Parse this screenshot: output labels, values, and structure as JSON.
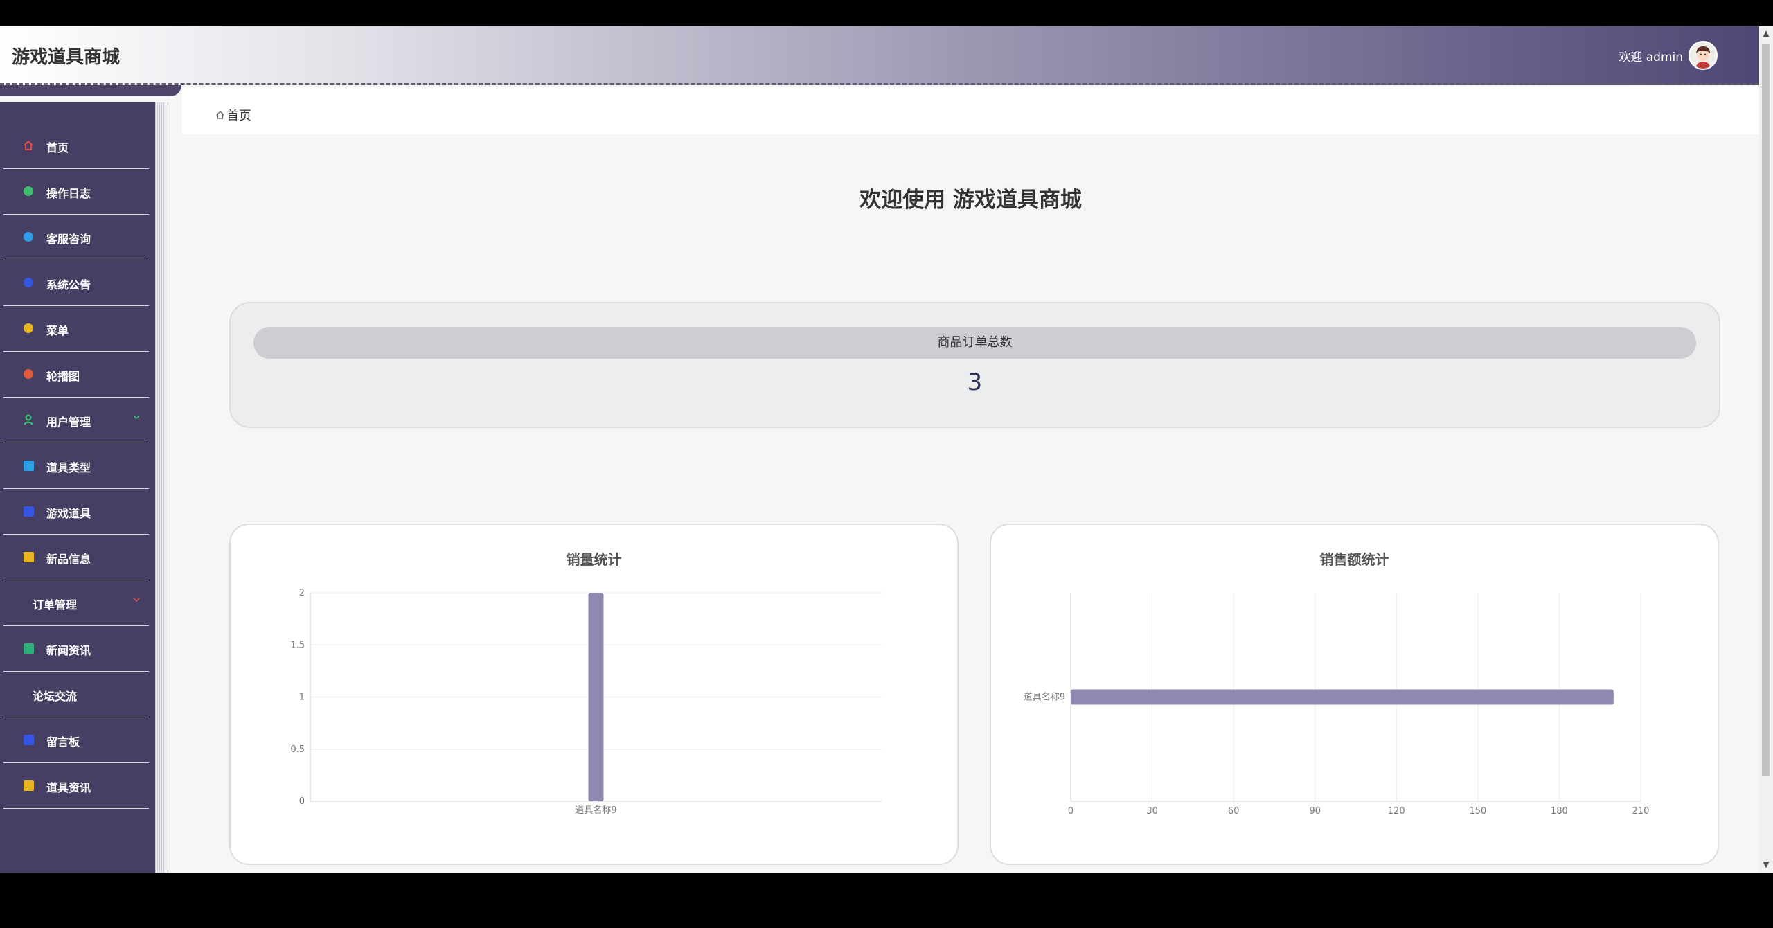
{
  "header": {
    "app_title": "游戏道具商城",
    "welcome": "欢迎 admin"
  },
  "sidebar": {
    "items": [
      {
        "label": "首页",
        "icon": "home-icon",
        "color": "#e05050"
      },
      {
        "label": "操作日志",
        "icon": "log-icon",
        "color": "#3bbf6e"
      },
      {
        "label": "客服咨询",
        "icon": "chat-icon",
        "color": "#2f9fe8"
      },
      {
        "label": "系统公告",
        "icon": "notice-icon",
        "color": "#3556e0"
      },
      {
        "label": "菜单",
        "icon": "menu-icon",
        "color": "#e6b520"
      },
      {
        "label": "轮播图",
        "icon": "carousel-icon",
        "color": "#e05a3a"
      },
      {
        "label": "用户管理",
        "icon": "user-icon",
        "color": "#37c877"
      },
      {
        "label": "道具类型",
        "icon": "category-icon",
        "color": "#2f9fe8"
      },
      {
        "label": "游戏道具",
        "icon": "item-icon",
        "color": "#3556e0"
      },
      {
        "label": "新品信息",
        "icon": "new-product-icon",
        "color": "#e6b520"
      },
      {
        "label": "订单管理",
        "icon": "",
        "color": ""
      },
      {
        "label": "新闻资讯",
        "icon": "news-icon",
        "color": "#2fb07a"
      },
      {
        "label": "论坛交流",
        "icon": "",
        "color": ""
      },
      {
        "label": "留言板",
        "icon": "message-board-icon",
        "color": "#3556e0"
      },
      {
        "label": "道具资讯",
        "icon": "item-news-icon",
        "color": "#e6b520"
      }
    ]
  },
  "breadcrumb": {
    "home": "首页"
  },
  "main": {
    "title": "欢迎使用 游戏道具商城",
    "stat": {
      "label": "商品订单总数",
      "value": "3"
    },
    "charts": [
      {
        "title": "销量统计"
      },
      {
        "title": "销售额统计"
      }
    ]
  },
  "colors": {
    "bar": "#8e89ae",
    "sidebar": "#463f63",
    "accent": "#2f2f58"
  },
  "chart_data": [
    {
      "type": "bar",
      "title": "销量统计",
      "categories": [
        "道具名称9"
      ],
      "values": [
        2
      ],
      "ylim": [
        0,
        2
      ],
      "yticks": [
        "0",
        "0.5",
        "1",
        "1.5",
        "2"
      ],
      "orientation": "vertical",
      "grid": true
    },
    {
      "type": "bar",
      "title": "销售额统计",
      "categories": [
        "道具名称9"
      ],
      "values": [
        200
      ],
      "xlim": [
        0,
        210
      ],
      "xticks": [
        "0",
        "30",
        "60",
        "90",
        "120",
        "150",
        "180",
        "210"
      ],
      "orientation": "horizontal",
      "grid": true
    }
  ]
}
